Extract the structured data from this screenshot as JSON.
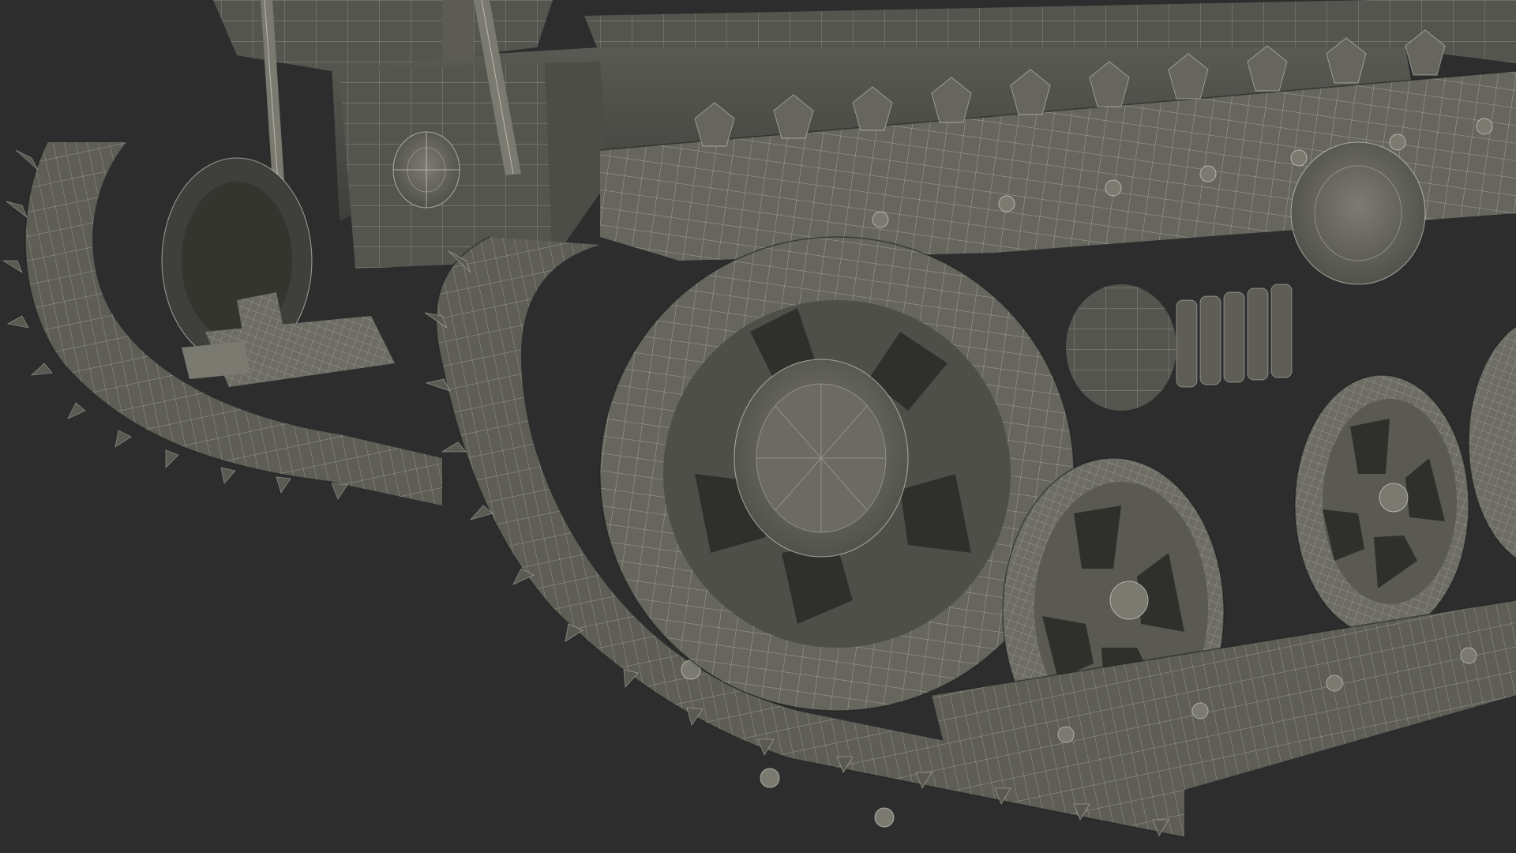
{
  "scene": {
    "background_color": "#2d2d2d",
    "model_base_color": "#66665e",
    "wireframe_color": "#e8e6dc",
    "shadow_color": "#3b3b37"
  }
}
